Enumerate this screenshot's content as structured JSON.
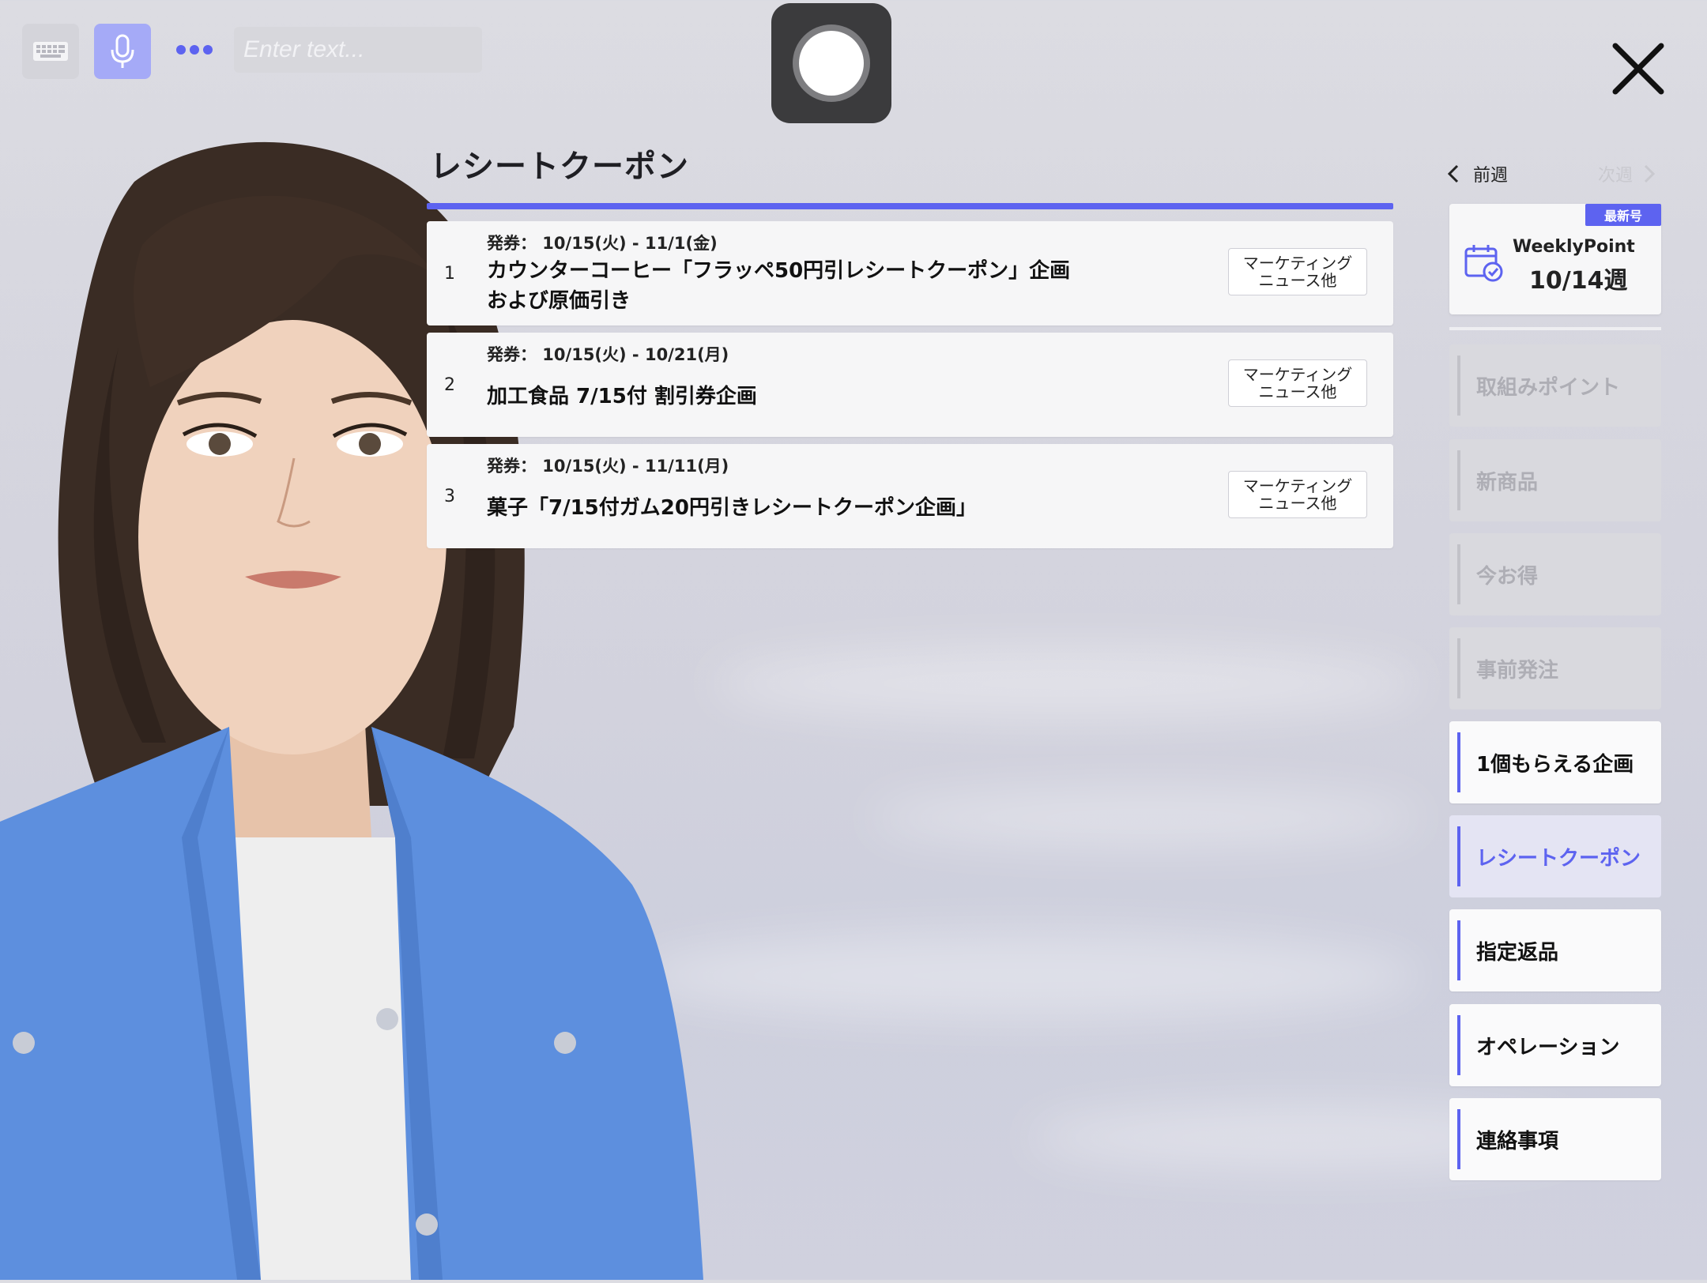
{
  "toolbar": {
    "keyboard_icon": "keyboard-icon",
    "mic_icon": "microphone-icon",
    "more_icon": "more-dots-icon",
    "input_placeholder": "Enter text...",
    "record_icon": "record-icon",
    "close_icon": "close-icon"
  },
  "main": {
    "title": "レシートクーポン",
    "coupons": [
      {
        "num": "1",
        "date": "発券： 10/15(火) - 11/1(金)",
        "title": "カウンターコーヒー「フラッペ50円引レシートクーポン」企画\nおよび原価引き",
        "tag": "マーケティング\nニュース他"
      },
      {
        "num": "2",
        "date": "発券： 10/15(火) - 10/21(月)",
        "title": "加工食品 7/15付 割引券企画",
        "tag": "マーケティング\nニュース他"
      },
      {
        "num": "3",
        "date": "発券： 10/15(火) - 11/11(月)",
        "title": "菓子「7/15付ガム20円引きレシートクーポン企画」",
        "tag": "マーケティング\nニュース他"
      }
    ]
  },
  "sidebar": {
    "prev_week": "前週",
    "next_week": "次週",
    "issue": {
      "badge": "最新号",
      "name": "WeeklyPoint",
      "week": "10/14週",
      "icon": "calendar-check-icon"
    },
    "items": [
      {
        "label": "取組みポイント",
        "state": "disabled"
      },
      {
        "label": "新商品",
        "state": "disabled"
      },
      {
        "label": "今お得",
        "state": "disabled"
      },
      {
        "label": "事前発注",
        "state": "disabled"
      },
      {
        "label": "1個もらえる企画",
        "state": "enabled"
      },
      {
        "label": "レシートクーポン",
        "state": "active"
      },
      {
        "label": "指定返品",
        "state": "enabled"
      },
      {
        "label": "オペレーション",
        "state": "enabled"
      },
      {
        "label": "連絡事項",
        "state": "enabled"
      }
    ]
  },
  "colors": {
    "accent": "#5d63f0",
    "mic_button": "#a5aaf7",
    "record_button": "#3b3b3d"
  }
}
